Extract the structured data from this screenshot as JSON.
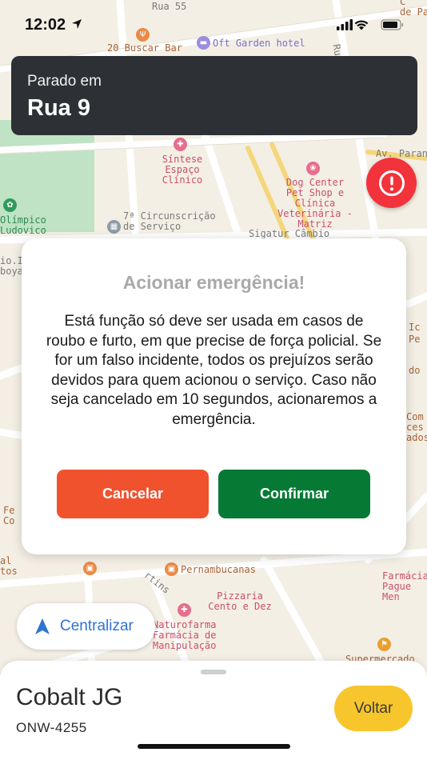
{
  "status_bar": {
    "time": "12:02"
  },
  "map": {
    "street_labels": [
      "Rua 55",
      "Av. Paran",
      "Ru"
    ],
    "pois": [
      {
        "name": "20 Buscar Bar",
        "color": "#a8643a",
        "icon": "fork-knife-icon"
      },
      {
        "name": "Oft Garden hotel",
        "color": "#7d6fc6",
        "icon": "bed-icon"
      },
      {
        "name": "Síntese Espaço Clínico",
        "color": "#c94f6d",
        "icon": "medical-icon"
      },
      {
        "name": "Dog Center Pet Shop e Clínica Veterinária - Matriz",
        "color": "#c94f6d",
        "icon": "paw-icon"
      },
      {
        "name": "7ª Circunscrição de Serviço",
        "color": "#7a7a7a",
        "icon": "building-icon"
      },
      {
        "name": "Olímpico Ludovico",
        "color": "#2f8a53",
        "icon": "park-icon"
      },
      {
        "name": "Sigatur Câmbio",
        "color": "#7a7a7a",
        "icon": ""
      },
      {
        "name": "Pernambucanas",
        "color": "#a8643a",
        "icon": "shopping-icon"
      },
      {
        "name": "Pizzaria Cento e Dez",
        "color": "#c94f6d",
        "icon": "fork-knife-icon"
      },
      {
        "name": "Naturofarma Farmácia de Manipulação",
        "color": "#c94f6d",
        "icon": "pharmacy-icon"
      },
      {
        "name": "Farmácia Pague Men",
        "color": "#c94f6d",
        "icon": ""
      },
      {
        "name": "Supermercado",
        "color": "#a8643a",
        "icon": "cart-icon"
      }
    ],
    "edge_fragments": {
      "top_right": [
        "C",
        "de Pa"
      ],
      "left_side": [
        "io.Il",
        "boya",
        "Fe",
        "Co",
        "al",
        "tos"
      ],
      "right_side": [
        "Ic",
        "Pe",
        "do",
        "Com",
        "ces",
        "ados"
      ],
      "rtins": "rtins"
    }
  },
  "banner": {
    "caption": "Parado em",
    "street": "Rua 9"
  },
  "emergency": {
    "color": "#f2333b",
    "icon": "alert-icon"
  },
  "dialog": {
    "title": "Acionar emergência!",
    "message": "Está função só deve ser usada em casos de roubo e furto, em que precise de força policial. Se for um falso incidente, todos os prejuízos serão devidos para quem acionou o serviço. Caso não seja cancelado em 10 segundos, acionaremos a emergência.",
    "cancel_label": "Cancelar",
    "confirm_label": "Confirmar",
    "cancel_color": "#f1522e",
    "confirm_color": "#067a34"
  },
  "centralize": {
    "label": "Centralizar",
    "icon": "navigation-arrow-icon"
  },
  "vehicle": {
    "name": "Cobalt JG",
    "plate": "ONW-4255",
    "back_label": "Voltar",
    "back_color": "#f7c52c"
  }
}
